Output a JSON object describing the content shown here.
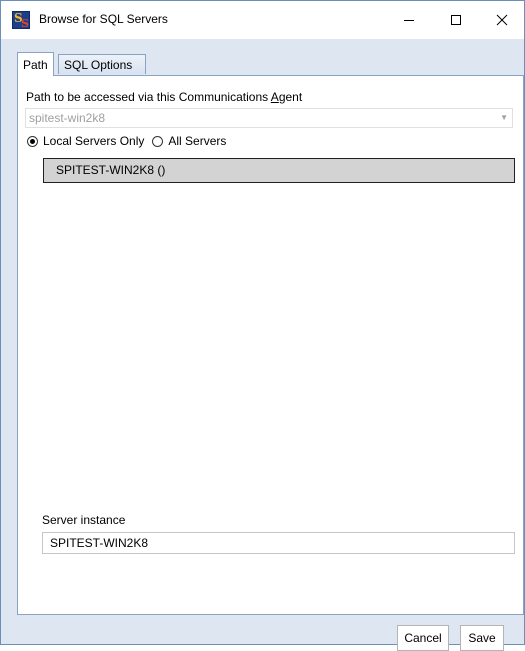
{
  "window": {
    "title": "Browse for SQL Servers",
    "app_icon": "sqs-logo-icon",
    "controls": {
      "minimize_icon": "minimize-icon",
      "maximize_icon": "maximize-icon",
      "close_icon": "close-icon"
    }
  },
  "tabs": [
    {
      "label": "Path",
      "active": true
    },
    {
      "label": "SQL Options",
      "active": false
    }
  ],
  "path_tab": {
    "label_prefix": "Path to be accessed via this Communications ",
    "label_accel": "A",
    "label_suffix": "gent",
    "combo_value": "spitest-win2k8",
    "combo_arrow": "▼",
    "radio_local": {
      "label": "Local Servers Only",
      "checked": true
    },
    "radio_all": {
      "label": "All Servers",
      "checked": false
    },
    "servers": [
      "SPITEST-WIN2K8 ()"
    ],
    "instance_label": "Server instance",
    "instance_value": "SPITEST-WIN2K8"
  },
  "buttons": {
    "cancel": "Cancel",
    "save": "Save"
  },
  "colors": {
    "window_bg": "#dde6f1",
    "border": "#6b8fb8",
    "selected_row": "#d3d3d3"
  }
}
